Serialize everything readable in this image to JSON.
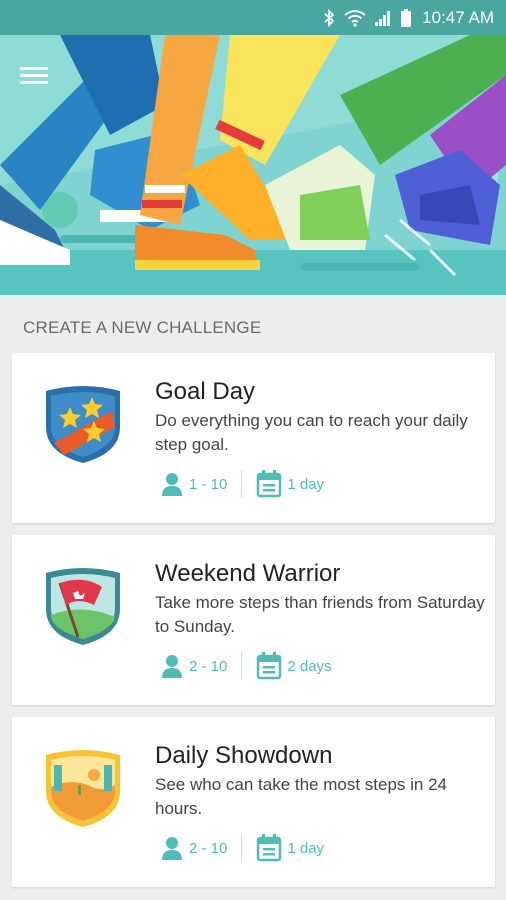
{
  "status_bar": {
    "time": "10:47 AM",
    "icons": [
      "bluetooth-icon",
      "wifi-icon",
      "signal-icon",
      "battery-icon"
    ]
  },
  "header": {
    "menu_icon": "hamburger-menu-icon",
    "illustration": "running-feet-illustration"
  },
  "section": {
    "title": "CREATE A NEW CHALLENGE"
  },
  "challenges": [
    {
      "title": "Goal Day",
      "description": "Do everything you can to reach your daily step goal.",
      "participants": "1 - 10",
      "duration": "1 day",
      "badge": "stars-badge-icon"
    },
    {
      "title": "Weekend Warrior",
      "description": "Take more steps than friends from Saturday to Sunday.",
      "participants": "2 - 10",
      "duration": "2 days",
      "badge": "flag-badge-icon"
    },
    {
      "title": "Daily Showdown",
      "description": "See who can take the most steps in 24 hours.",
      "participants": "2 - 10",
      "duration": "1 day",
      "badge": "desert-badge-icon"
    }
  ],
  "colors": {
    "accent": "#4dbdb6",
    "status_bar": "#49a7a0",
    "background": "#eceeee"
  }
}
